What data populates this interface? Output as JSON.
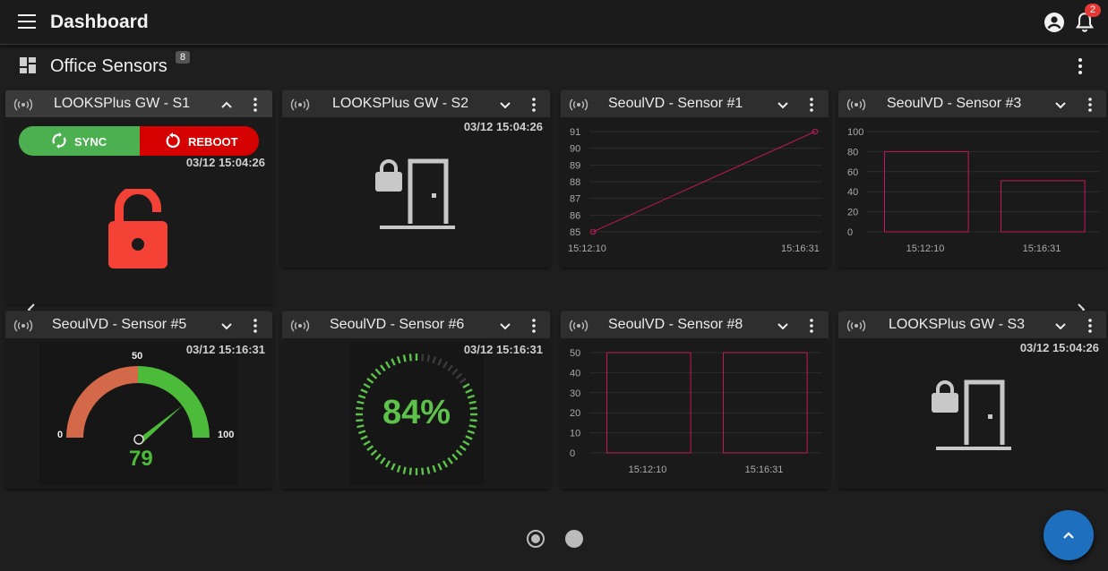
{
  "topbar": {
    "title": "Dashboard",
    "notification_count": "2"
  },
  "section": {
    "title": "Office Sensors",
    "count": "8"
  },
  "cards": {
    "s1": {
      "name": "LOOKSPlus GW - S1",
      "sync_label": "SYNC",
      "reboot_label": "REBOOT",
      "timestamp": "03/12 15:04:26",
      "lock_state": "unlocked",
      "lock_color": "#f44336"
    },
    "s2": {
      "name": "LOOKSPlus GW - S2",
      "timestamp": "03/12 15:04:26"
    },
    "sensor1": {
      "name": "SeoulVD - Sensor #1"
    },
    "sensor3": {
      "name": "SeoulVD - Sensor #3"
    },
    "sensor5": {
      "name": "SeoulVD - Sensor #5",
      "timestamp": "03/12 15:16:31",
      "gauge_value": "79",
      "gauge_min": "0",
      "gauge_mid": "50",
      "gauge_max": "100"
    },
    "sensor6": {
      "name": "SeoulVD - Sensor #6",
      "timestamp": "03/12 15:16:31",
      "percent_label": "84%",
      "percent_value": 84
    },
    "sensor8": {
      "name": "SeoulVD - Sensor #8"
    },
    "s3": {
      "name": "LOOKSPlus GW - S3",
      "timestamp": "03/12 15:04:26"
    }
  },
  "chart_data": [
    {
      "chart": "SeoulVD - Sensor #1",
      "type": "line",
      "x": [
        "15:12:10",
        "15:16:31"
      ],
      "values": [
        85,
        91
      ],
      "yticks": [
        85,
        86,
        87,
        88,
        89,
        90,
        91
      ],
      "ylim": [
        85,
        91
      ],
      "color": "#c2185b"
    },
    {
      "chart": "SeoulVD - Sensor #3",
      "type": "bar",
      "categories": [
        "15:12:10",
        "15:16:31"
      ],
      "values": [
        80,
        51
      ],
      "yticks": [
        0,
        20,
        40,
        60,
        80,
        100
      ],
      "ylim": [
        0,
        100
      ],
      "color": "#c2185b"
    },
    {
      "chart": "SeoulVD - Sensor #8",
      "type": "bar",
      "categories": [
        "15:12:10",
        "15:16:31"
      ],
      "values": [
        50,
        50
      ],
      "yticks": [
        0,
        10,
        20,
        30,
        40,
        50
      ],
      "ylim": [
        0,
        50
      ],
      "color": "#c2185b"
    }
  ],
  "colors": {
    "sync": "#4caf50",
    "reboot": "#d50000",
    "gauge_low": "#d4694a",
    "gauge_high": "#4cbb3a",
    "gauge_text": "#4cbb3a",
    "fab": "#1e6fbd"
  },
  "pagination": {
    "pages": 2,
    "current": 1
  }
}
